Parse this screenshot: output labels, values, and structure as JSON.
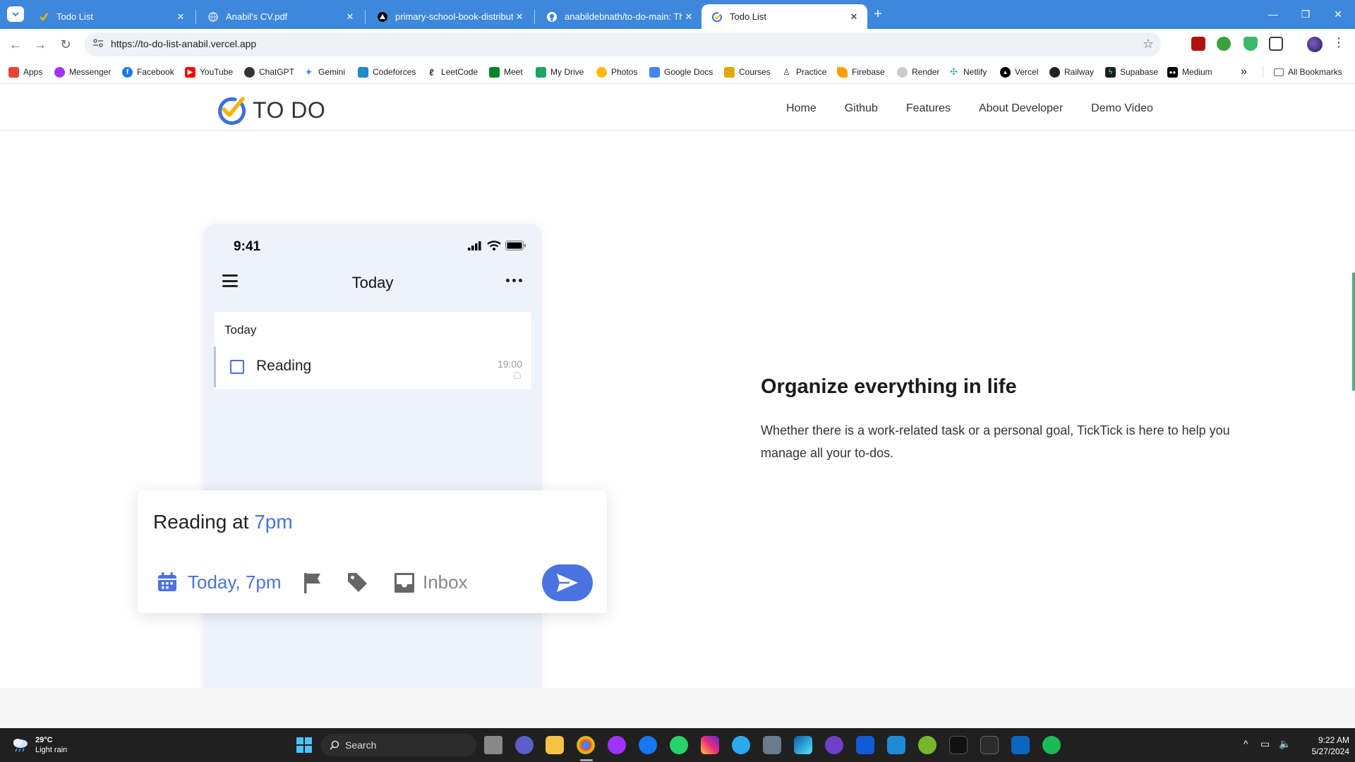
{
  "browser": {
    "tabs": [
      {
        "title": "Todo List",
        "close": "✕"
      },
      {
        "title": "Anabil's CV.pdf",
        "close": "✕"
      },
      {
        "title": "primary-school-book-distributi",
        "close": "✕"
      },
      {
        "title": "anabildebnath/to-do-main: Thi",
        "close": "✕"
      },
      {
        "title": "Todo List",
        "close": "✕",
        "active": true
      }
    ],
    "new_tab": "+",
    "window_controls": {
      "minimize": "—",
      "restore": "❐",
      "close": "✕"
    },
    "url": "https://to-do-list-anabil.vercel.app",
    "nav": {
      "back": "←",
      "forward": "→",
      "reload": "↻"
    },
    "bookmarks": [
      {
        "label": "Apps",
        "icon": "apps-grid-icon",
        "color": "#ea4335"
      },
      {
        "label": "Messenger",
        "icon": "messenger-icon",
        "color": "#a033ff"
      },
      {
        "label": "Facebook",
        "icon": "facebook-icon",
        "color": "#1877f2"
      },
      {
        "label": "YouTube",
        "icon": "youtube-icon",
        "color": "#ff0000"
      },
      {
        "label": "ChatGPT",
        "icon": "chatgpt-icon",
        "color": "#333333"
      },
      {
        "label": "Gemini",
        "icon": "gemini-icon",
        "color": "#4285f4"
      },
      {
        "label": "Codeforces",
        "icon": "codeforces-icon",
        "color": "#1f8acb"
      },
      {
        "label": "LeetCode",
        "icon": "leetcode-icon",
        "color": "#333333"
      },
      {
        "label": "Meet",
        "icon": "meet-icon",
        "color": "#00832d"
      },
      {
        "label": "My Drive",
        "icon": "drive-icon",
        "color": "#1fa463"
      },
      {
        "label": "Photos",
        "icon": "photos-icon",
        "color": "#fbbc04"
      },
      {
        "label": "Google Docs",
        "icon": "docs-icon",
        "color": "#4285f4"
      },
      {
        "label": "Courses",
        "icon": "courses-icon",
        "color": "#e0a800"
      },
      {
        "label": "Practice",
        "icon": "practice-icon",
        "color": "#333333"
      },
      {
        "label": "Firebase",
        "icon": "firebase-icon",
        "color": "#ffa000"
      },
      {
        "label": "Render",
        "icon": "render-icon",
        "color": "#cccccc"
      },
      {
        "label": "Netlify",
        "icon": "netlify-icon",
        "color": "#32b3a6"
      },
      {
        "label": "Vercel",
        "icon": "vercel-icon",
        "color": "#000000"
      },
      {
        "label": "Railway",
        "icon": "railway-icon",
        "color": "#222222"
      },
      {
        "label": "Supabase",
        "icon": "supabase-icon",
        "color": "#1f1f1f"
      },
      {
        "label": "Medium",
        "icon": "medium-icon",
        "color": "#000000"
      }
    ],
    "bookmarks_overflow": "»",
    "all_bookmarks": "All Bookmarks"
  },
  "site": {
    "brand": "TO DO",
    "nav": [
      "Home",
      "Github",
      "Features",
      "About Developer",
      "Demo Video"
    ],
    "phone": {
      "time": "9:41",
      "title": "Today",
      "section": "Today",
      "task": {
        "name": "Reading",
        "time": "19:00"
      }
    },
    "quick_add": {
      "text": "Reading at ",
      "time": "7pm",
      "date": "Today, 7pm",
      "list": "Inbox"
    },
    "hero": {
      "title": "Organize everything in life",
      "description": "Whether there is a work-related task or a personal goal, TickTick is here to help you manage all your to-dos."
    },
    "colors": {
      "accent": "#4b73e0",
      "brand_blue": "#3b6fe0",
      "brand_yellow": "#f5b400"
    }
  },
  "taskbar": {
    "weather": {
      "temp": "29°C",
      "desc": "Light rain"
    },
    "search": "Search",
    "time": "9:22 AM",
    "date": "5/27/2024"
  }
}
